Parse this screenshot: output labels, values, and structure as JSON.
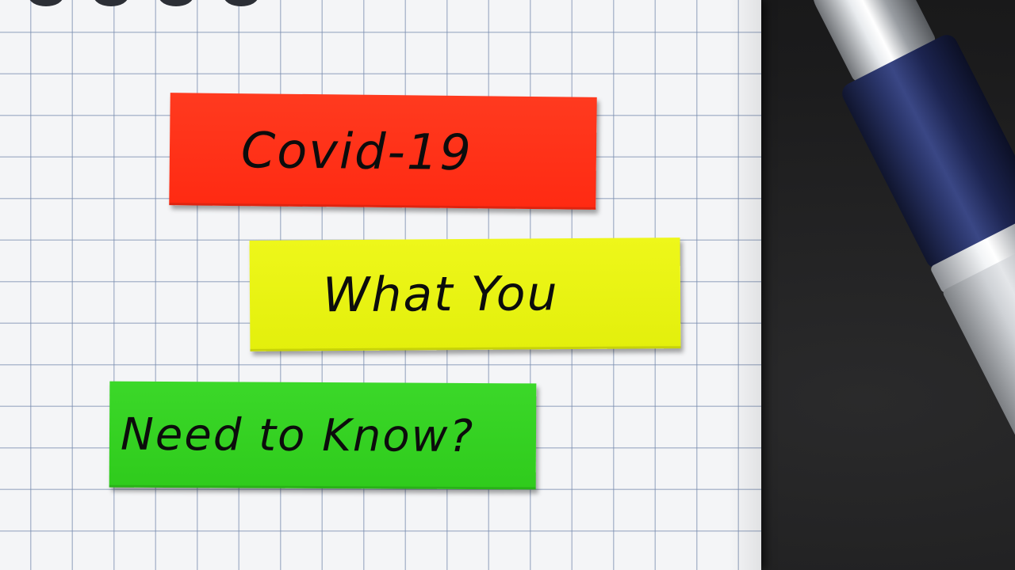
{
  "labels": {
    "red": {
      "text": "Covid-19",
      "color": "#ff2e16"
    },
    "yellow": {
      "text": "What You",
      "color": "#e9f314"
    },
    "green": {
      "text": "Need to Know?",
      "color": "#35d021"
    }
  },
  "scene": {
    "background": "notebook-grid-paper",
    "accent_object": "pen-icon",
    "surface_color": "#1e1e1f"
  }
}
